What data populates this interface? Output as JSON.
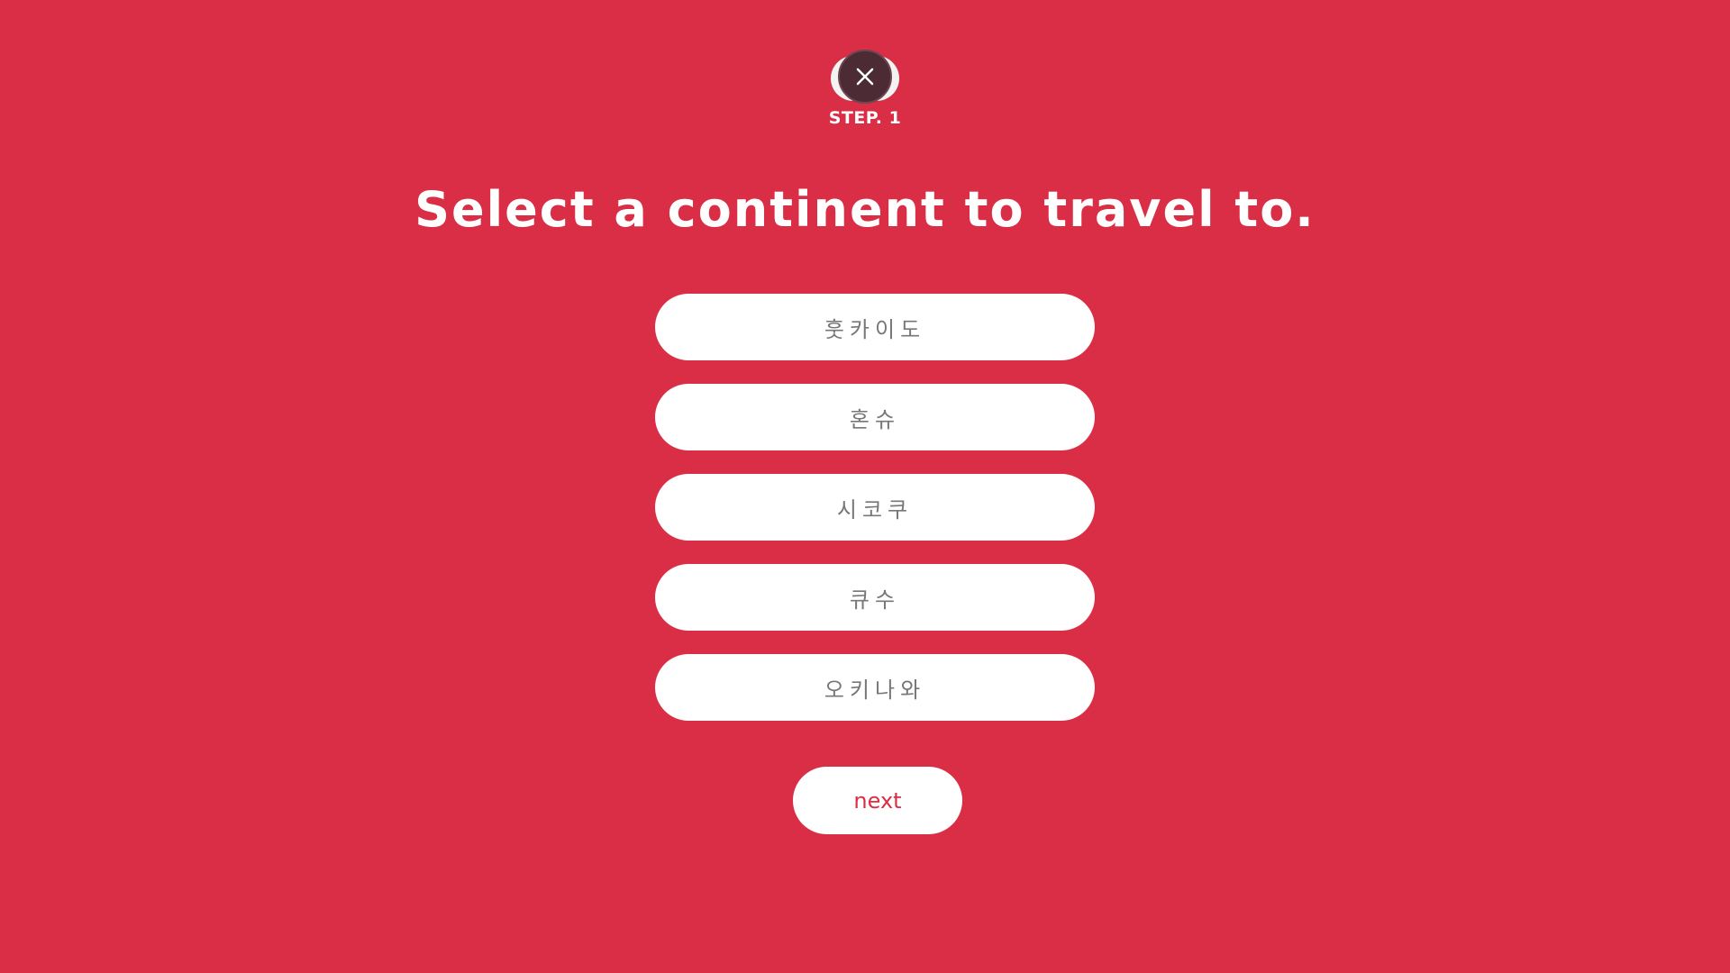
{
  "header": {
    "step_label": "STEP. 1",
    "close_icon": "close-icon",
    "logo_icon": "brand-logo-icon"
  },
  "main": {
    "title": "Select a continent to travel to.",
    "options": [
      {
        "label": "훗카이도"
      },
      {
        "label": "혼슈"
      },
      {
        "label": "시코쿠"
      },
      {
        "label": "큐수"
      },
      {
        "label": "오키나와"
      }
    ],
    "next_label": "next"
  },
  "colors": {
    "background": "#d92e46",
    "button": "#ffffff",
    "option_text": "#777777",
    "next_text": "#d92e46"
  }
}
